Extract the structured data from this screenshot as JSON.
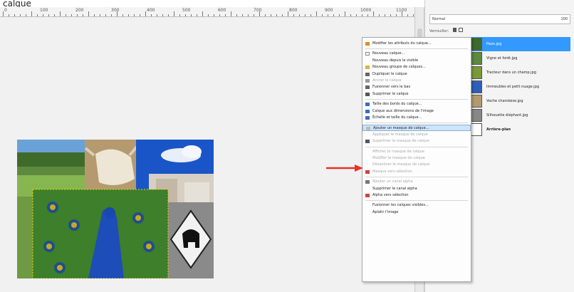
{
  "top_text": "calque",
  "ruler": {
    "ticks": [
      "0",
      "100",
      "200",
      "300",
      "400",
      "500",
      "600",
      "700",
      "800",
      "900",
      "1000",
      "1100"
    ]
  },
  "panel": {
    "mode_label": "Normal",
    "opacity_value": "100",
    "lock_label": "Verrouiller:",
    "layers": [
      {
        "name": "Paon.jpg",
        "selected": true
      },
      {
        "name": "Vigne et forêt.jpg",
        "selected": false
      },
      {
        "name": "Tracteur dans un champ.jpg",
        "selected": false
      },
      {
        "name": "Immeubles et petit nuage.jpg",
        "selected": false
      },
      {
        "name": "Vache charolaise.jpg",
        "selected": false
      },
      {
        "name": "Silhouette éléphant.jpg",
        "selected": false
      },
      {
        "name": "Arrière-plan",
        "selected": false
      }
    ]
  },
  "menu": {
    "items": [
      {
        "label": "Modifier les attributs du calque...",
        "enabled": true,
        "icon": "pencil-icon"
      },
      {
        "sep": true
      },
      {
        "label": "Nouveau calque...",
        "enabled": true,
        "icon": "page-icon"
      },
      {
        "label": "Nouveau depuis le visible",
        "enabled": true,
        "icon": ""
      },
      {
        "label": "Nouveau groupe de calques...",
        "enabled": true,
        "icon": "folder-icon"
      },
      {
        "label": "Dupliquer le calque",
        "enabled": true,
        "icon": "duplicate-icon"
      },
      {
        "label": "Ancrer le calque",
        "enabled": false,
        "icon": "anchor-icon"
      },
      {
        "label": "Fusionner vers le bas",
        "enabled": true,
        "icon": "merge-icon"
      },
      {
        "label": "Supprimer le calque",
        "enabled": true,
        "icon": "trash-icon"
      },
      {
        "sep": true
      },
      {
        "label": "Taille des bords du calque...",
        "enabled": true,
        "icon": "resize-icon"
      },
      {
        "label": "Calque aux dimensions de l'image",
        "enabled": true,
        "icon": "fit-icon"
      },
      {
        "label": "Échelle et taille du calque...",
        "enabled": true,
        "icon": "scale-icon"
      },
      {
        "sep": true
      },
      {
        "label": "Ajouter un masque de calque...",
        "enabled": true,
        "icon": "mask-icon",
        "highlight": true
      },
      {
        "label": "Appliquer le masque de calque",
        "enabled": false,
        "icon": ""
      },
      {
        "label": "Supprimer le masque de calque",
        "enabled": false,
        "icon": "trash-icon"
      },
      {
        "sep": true
      },
      {
        "label": "Afficher le masque de calque",
        "enabled": false,
        "icon": ""
      },
      {
        "label": "Modifier le masque de calque",
        "enabled": false,
        "icon": ""
      },
      {
        "label": "Désactiver le masque de calque",
        "enabled": false,
        "icon": ""
      },
      {
        "label": "Masque vers sélection",
        "enabled": false,
        "icon": "selection-icon"
      },
      {
        "sep": true
      },
      {
        "label": "Ajouter un canal alpha",
        "enabled": false,
        "icon": "alpha-icon"
      },
      {
        "label": "Supprimer le canal alpha",
        "enabled": true,
        "icon": ""
      },
      {
        "label": "Alpha vers sélection",
        "enabled": true,
        "icon": "alpha-selection-icon"
      },
      {
        "sep": true
      },
      {
        "label": "Fusionner les calques visibles...",
        "enabled": true,
        "icon": ""
      },
      {
        "label": "Aplatir l'image",
        "enabled": true,
        "icon": ""
      }
    ]
  },
  "colors": {
    "selection": "#3399ff",
    "arrow": "#e8322c",
    "highlight": "#cfe3f7"
  }
}
